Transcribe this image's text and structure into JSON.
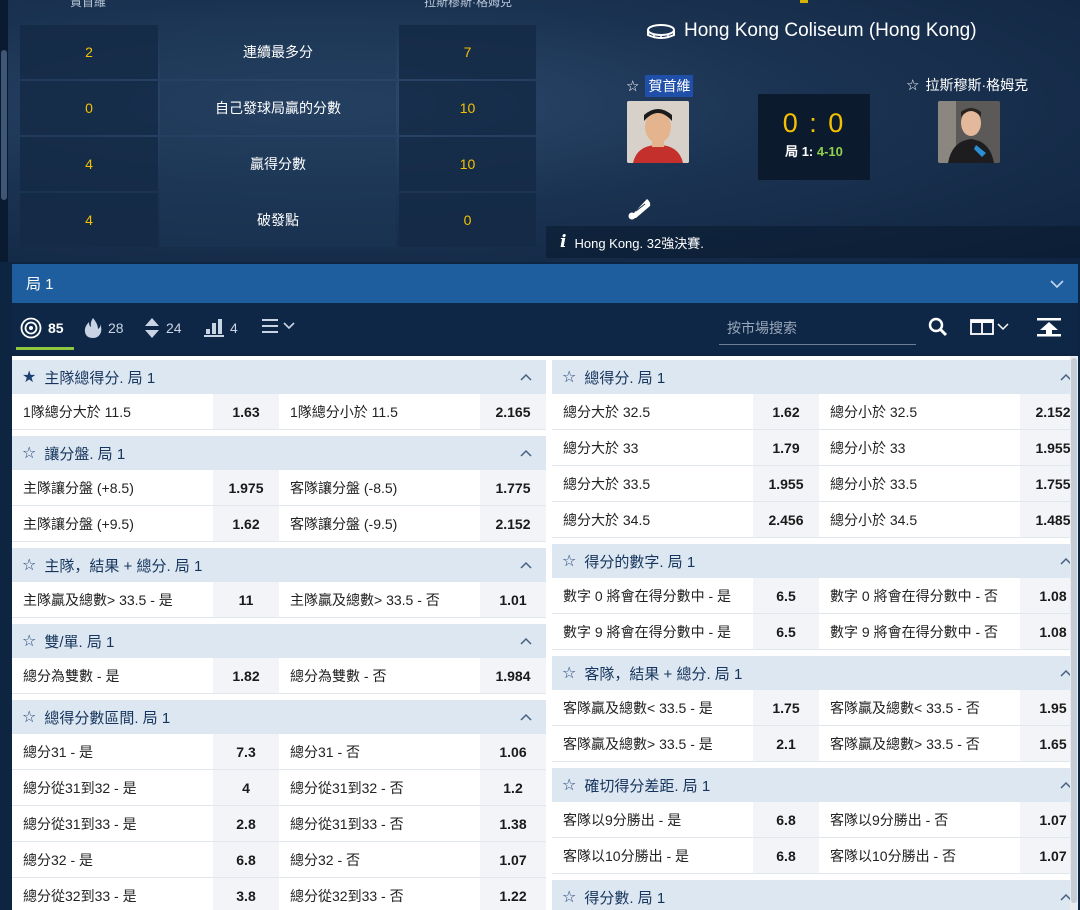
{
  "stats": {
    "head_left": "賀首維",
    "head_right": "拉斯穆斯·格姆克",
    "rows": [
      {
        "left": "2",
        "label": "連續最多分",
        "right": "7"
      },
      {
        "left": "0",
        "label": "自己發球局贏的分數",
        "right": "10"
      },
      {
        "left": "4",
        "label": "贏得分數",
        "right": "10"
      },
      {
        "left": "4",
        "label": "破發點",
        "right": "0"
      }
    ]
  },
  "match": {
    "venue": "Hong Kong Coliseum (Hong Kong)",
    "player1": "賀首維",
    "player2": "拉斯穆斯·格姆克",
    "score": "0 : 0",
    "set_label": "局 1:",
    "set_score": "4-10",
    "info": "Hong Kong. 32強決賽."
  },
  "set_bar": {
    "label": "局 1"
  },
  "filters": {
    "all_count": "85",
    "hot_count": "28",
    "updown_count": "24",
    "stats_count": "4",
    "search_placeholder": "按市場搜索"
  },
  "colors": {
    "accent": "#f5c100",
    "set_green": "#8fd04c",
    "bar_blue": "#1e5d9e",
    "header_bg": "#dce7f2"
  },
  "markets_left": [
    {
      "title": "主隊總得分. 局 1",
      "starred": true,
      "rows": [
        [
          "1隊總分大於 11.5",
          "1.63",
          "1隊總分小於 11.5",
          "2.165"
        ]
      ]
    },
    {
      "title": "讓分盤. 局 1",
      "starred": false,
      "rows": [
        [
          "主隊讓分盤 (+8.5)",
          "1.975",
          "客隊讓分盤 (-8.5)",
          "1.775"
        ],
        [
          "主隊讓分盤 (+9.5)",
          "1.62",
          "客隊讓分盤 (-9.5)",
          "2.152"
        ]
      ]
    },
    {
      "title": "主隊，結果 + 總分. 局 1",
      "starred": false,
      "rows": [
        [
          "主隊贏及總數> 33.5 - 是",
          "11",
          "主隊贏及總數> 33.5 - 否",
          "1.01"
        ]
      ]
    },
    {
      "title": "雙/單. 局 1",
      "starred": false,
      "rows": [
        [
          "總分為雙數 - 是",
          "1.82",
          "總分為雙數 - 否",
          "1.984"
        ]
      ]
    },
    {
      "title": "總得分數區間. 局 1",
      "starred": false,
      "rows": [
        [
          "總分31 - 是",
          "7.3",
          "總分31 - 否",
          "1.06"
        ],
        [
          "總分從31到32 - 是",
          "4",
          "總分從31到32 - 否",
          "1.2"
        ],
        [
          "總分從31到33 - 是",
          "2.8",
          "總分從31到33 - 否",
          "1.38"
        ],
        [
          "總分32 - 是",
          "6.8",
          "總分32 - 否",
          "1.07"
        ],
        [
          "總分從32到33 - 是",
          "3.8",
          "總分從32到33 - 否",
          "1.22"
        ]
      ]
    }
  ],
  "markets_right": [
    {
      "title": "總得分. 局 1",
      "starred": false,
      "rows": [
        [
          "總分大於 32.5",
          "1.62",
          "總分小於 32.5",
          "2.152"
        ],
        [
          "總分大於 33",
          "1.79",
          "總分小於 33",
          "1.955"
        ],
        [
          "總分大於 33.5",
          "1.955",
          "總分小於 33.5",
          "1.755"
        ],
        [
          "總分大於 34.5",
          "2.456",
          "總分小於 34.5",
          "1.485"
        ]
      ]
    },
    {
      "title": "得分的數字. 局 1",
      "starred": false,
      "rows": [
        [
          "數字 0 將會在得分數中 - 是",
          "6.5",
          "數字 0 將會在得分數中 - 否",
          "1.08"
        ],
        [
          "數字 9 將會在得分數中 - 是",
          "6.5",
          "數字 9 將會在得分數中 - 否",
          "1.08"
        ]
      ]
    },
    {
      "title": "客隊，結果 + 總分. 局 1",
      "starred": false,
      "rows": [
        [
          "客隊贏及總數< 33.5 - 是",
          "1.75",
          "客隊贏及總數< 33.5 - 否",
          "1.95"
        ],
        [
          "客隊贏及總數> 33.5 - 是",
          "2.1",
          "客隊贏及總數> 33.5 - 否",
          "1.65"
        ]
      ]
    },
    {
      "title": "確切得分差距. 局 1",
      "starred": false,
      "rows": [
        [
          "客隊以9分勝出 - 是",
          "6.8",
          "客隊以9分勝出 - 否",
          "1.07"
        ],
        [
          "客隊以10分勝出 - 是",
          "6.8",
          "客隊以10分勝出 - 否",
          "1.07"
        ]
      ]
    },
    {
      "title": "得分數. 局 1",
      "starred": false,
      "rows": []
    }
  ]
}
